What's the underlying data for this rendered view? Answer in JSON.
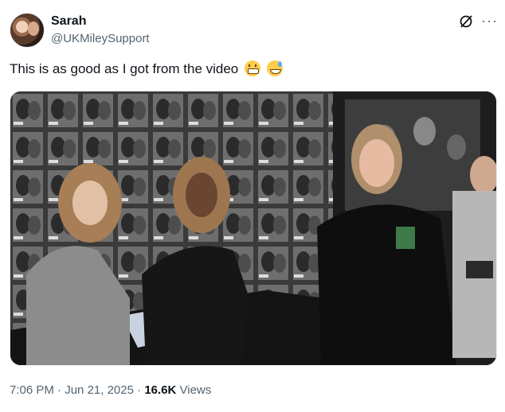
{
  "author": {
    "name": "Sarah",
    "handle": "@UKMileySupport"
  },
  "actions": {
    "grok_icon": "grok-icon",
    "more_icon": "more-icon",
    "more_glyph": "···"
  },
  "tweet": {
    "text": "This is as good as I got from the video",
    "emojis": [
      "grimacing-face-emoji",
      "grinning-face-with-sweat-emoji"
    ]
  },
  "meta": {
    "time": "7:06 PM",
    "separator": "·",
    "date": "Jun 21, 2025",
    "views_count": "16.6K",
    "views_label": "Views"
  }
}
